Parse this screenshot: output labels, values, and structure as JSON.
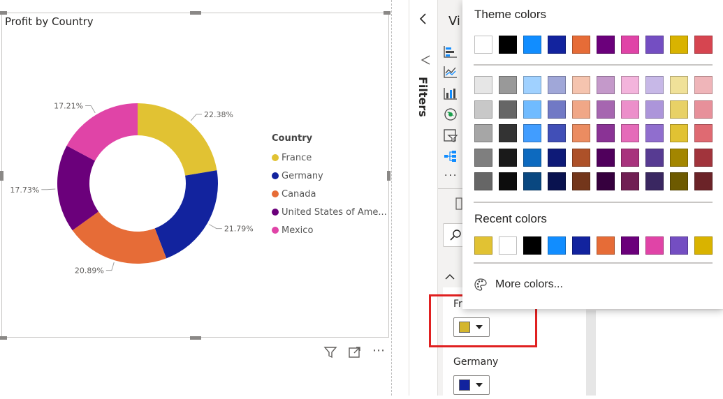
{
  "visual": {
    "title": "Profit by Country",
    "legend_title": "Country"
  },
  "chart_data": {
    "type": "pie",
    "variant": "donut",
    "title": "Profit by Country",
    "legend_title": "Country",
    "categories": [
      "France",
      "Germany",
      "Canada",
      "United States of Ame...",
      "Mexico"
    ],
    "values": [
      22.38,
      21.79,
      20.89,
      17.73,
      17.21
    ],
    "value_labels": [
      "22.38%",
      "21.79%",
      "20.89%",
      "17.73%",
      "17.21%"
    ],
    "colors": [
      "#e1c233",
      "#12239e",
      "#e66c37",
      "#6b007b",
      "#e044a7"
    ],
    "legend_position": "right"
  },
  "pane": {
    "view_label": "Vi",
    "filters_label": "Filters",
    "more_label": "...",
    "series": [
      {
        "label": "Fr",
        "color": "#d4b62d"
      },
      {
        "label": "Germany",
        "color": "#12239e"
      }
    ]
  },
  "picker": {
    "theme_title": "Theme colors",
    "recent_title": "Recent colors",
    "more_colors": "More colors...",
    "theme_row": [
      "#ffffff",
      "#000000",
      "#118dff",
      "#12239e",
      "#e66c37",
      "#6b007b",
      "#e044a7",
      "#744ec2",
      "#d9b300",
      "#d64550"
    ],
    "shades": [
      [
        "#e6e6e6",
        "#999999",
        "#a0d1ff",
        "#a0a7d8",
        "#f5c4af",
        "#c499ca",
        "#f3b4dc",
        "#c7b8e7",
        "#f0e199",
        "#efb5b9"
      ],
      [
        "#c8c8c8",
        "#666666",
        "#70bbff",
        "#7179c5",
        "#f0a787",
        "#a666b0",
        "#ec8fca",
        "#ac95da",
        "#e8d166",
        "#e7909a"
      ],
      [
        "#a6a6a6",
        "#333333",
        "#419dff",
        "#414fb7",
        "#eb8c61",
        "#8a3395",
        "#e56bb9",
        "#906ece",
        "#e1c233",
        "#df6a72"
      ],
      [
        "#7f7f7f",
        "#1a1a1a",
        "#0d6abf",
        "#0e1a77",
        "#ad5129",
        "#50005c",
        "#a8337d",
        "#573b92",
        "#a38600",
        "#a1343c"
      ],
      [
        "#666666",
        "#0d0d0d",
        "#094780",
        "#09124f",
        "#73361b",
        "#36003e",
        "#701f53",
        "#3a2761",
        "#6d5a00",
        "#6b2328"
      ]
    ],
    "recent": [
      "#e1c233",
      "#ffffff",
      "#000000",
      "#118dff",
      "#12239e",
      "#e66c37",
      "#6b007b",
      "#e044a7",
      "#744ec2",
      "#d9b300"
    ]
  }
}
